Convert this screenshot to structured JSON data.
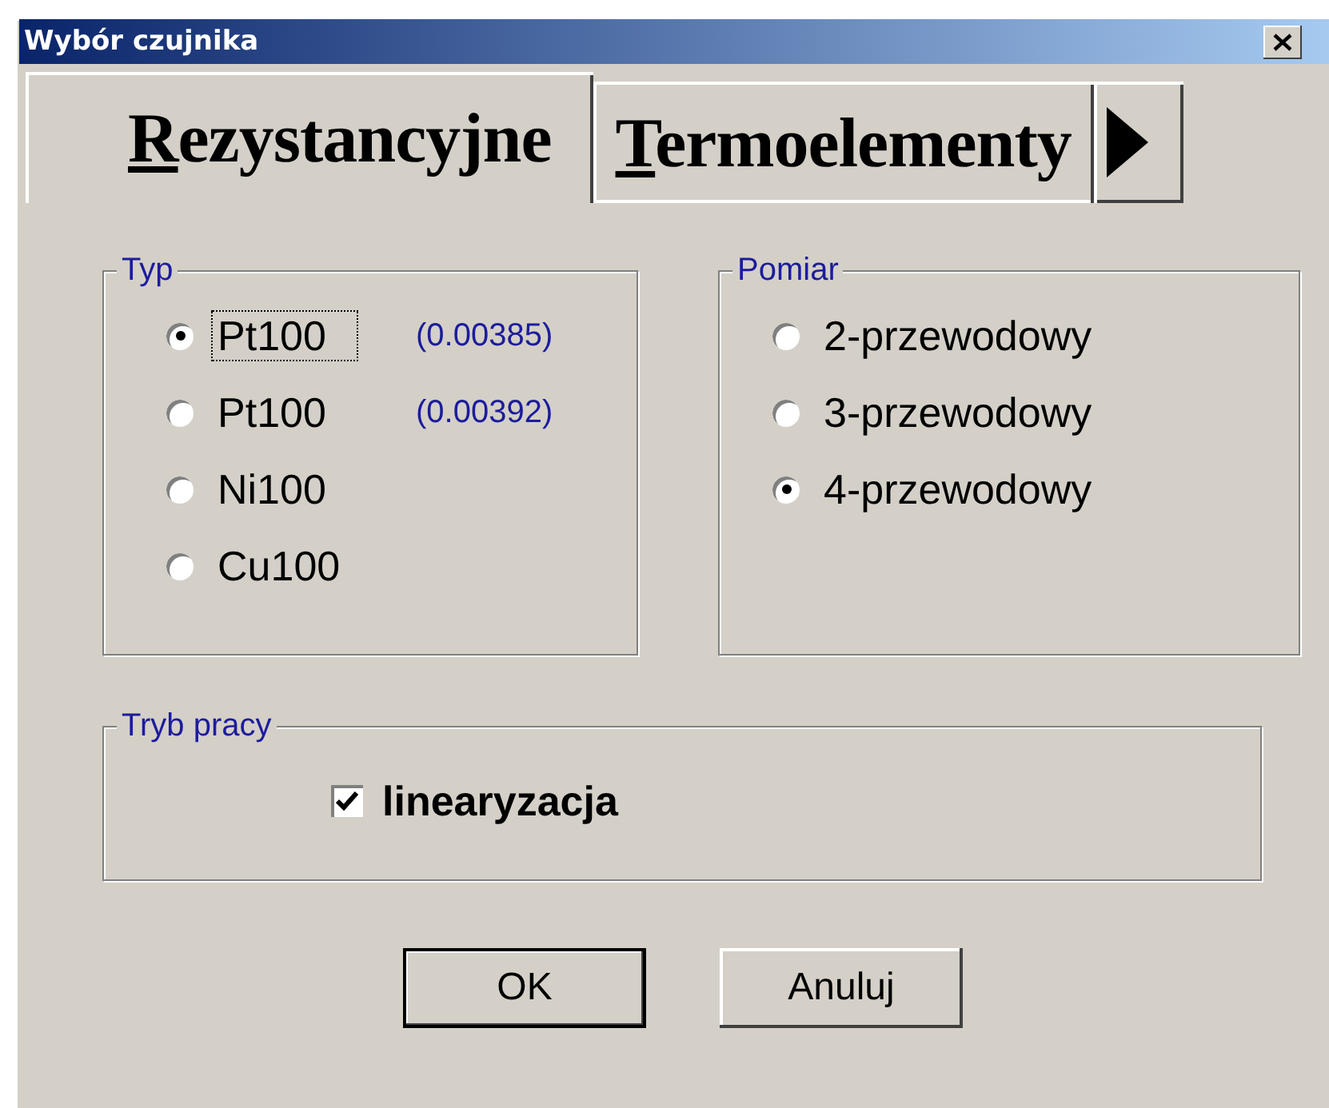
{
  "window": {
    "title": "Wybór czujnika"
  },
  "tabs": [
    {
      "label": "Rezystancyjne",
      "selected": true
    },
    {
      "label": "Termoelementy",
      "selected": false
    }
  ],
  "typ": {
    "legend": "Typ",
    "options": [
      {
        "label": "Pt100",
        "note": "(0.00385)",
        "selected": true,
        "focused": true
      },
      {
        "label": "Pt100",
        "note": "(0.00392)",
        "selected": false,
        "focused": false
      },
      {
        "label": "Ni100",
        "selected": false,
        "focused": false
      },
      {
        "label": "Cu100",
        "selected": false,
        "focused": false
      }
    ]
  },
  "pomiar": {
    "legend": "Pomiar",
    "options": [
      {
        "label": "2-przewodowy",
        "selected": false
      },
      {
        "label": "3-przewodowy",
        "selected": false
      },
      {
        "label": "4-przewodowy",
        "selected": true
      }
    ]
  },
  "tryb_pracy": {
    "legend": "Tryb pracy",
    "checkbox": {
      "label": "linearyzacja",
      "checked": true
    }
  },
  "buttons": [
    {
      "label": "OK",
      "default": true
    },
    {
      "label": "Anuluj",
      "default": false
    }
  ]
}
